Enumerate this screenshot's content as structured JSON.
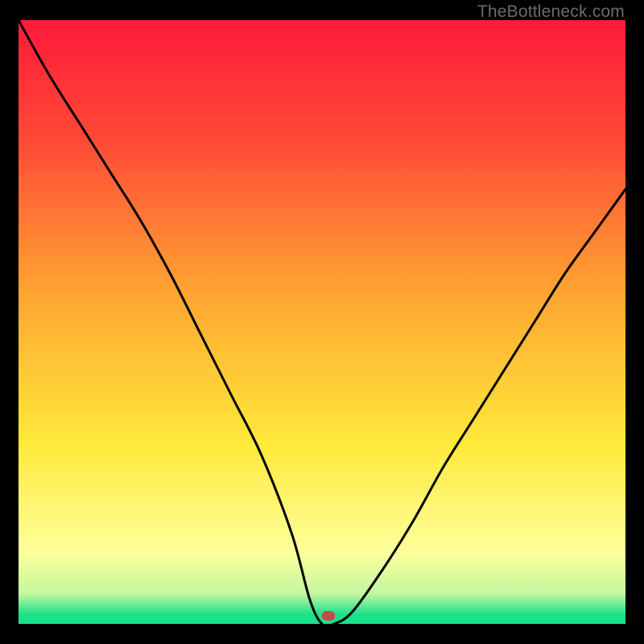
{
  "watermark": "TheBottleneck.com",
  "colors": {
    "black": "#000000",
    "red_top": "#ff1a3a",
    "orange": "#ff8a2a",
    "yellow": "#ffe93a",
    "pale_yellow": "#ffff9a",
    "green": "#19e08a",
    "marker": "#c74a4a",
    "curve": "#000000",
    "watermark_text": "#6b6b6b"
  },
  "chart_data": {
    "type": "line",
    "title": "",
    "xlabel": "",
    "ylabel": "",
    "xlim": [
      0,
      100
    ],
    "ylim": [
      0,
      100
    ],
    "grid": false,
    "legend": false,
    "annotations": [
      {
        "type": "marker",
        "x": 51,
        "y": 1,
        "color": "#c74a4a",
        "shape": "rounded-rect"
      }
    ],
    "series": [
      {
        "name": "bottleneck-curve",
        "x": [
          0,
          5,
          10,
          15,
          20,
          25,
          30,
          35,
          40,
          45,
          48,
          50,
          52,
          55,
          60,
          65,
          70,
          75,
          80,
          85,
          90,
          95,
          100
        ],
        "values": [
          100,
          91,
          83,
          75,
          67,
          58,
          48,
          38,
          28,
          15,
          4,
          0,
          0,
          2,
          9,
          17,
          26,
          34,
          42,
          50,
          58,
          65,
          72
        ]
      }
    ],
    "background_gradient": {
      "type": "vertical-linear",
      "stops": [
        {
          "pos": 0.0,
          "color": "#ff1a3a"
        },
        {
          "pos": 0.2,
          "color": "#ff4a36"
        },
        {
          "pos": 0.45,
          "color": "#ffa432"
        },
        {
          "pos": 0.7,
          "color": "#ffe93a"
        },
        {
          "pos": 0.88,
          "color": "#ffff9a"
        },
        {
          "pos": 0.95,
          "color": "#c3f7a0"
        },
        {
          "pos": 0.985,
          "color": "#19e08a"
        },
        {
          "pos": 1.0,
          "color": "#19e08a"
        }
      ]
    }
  }
}
